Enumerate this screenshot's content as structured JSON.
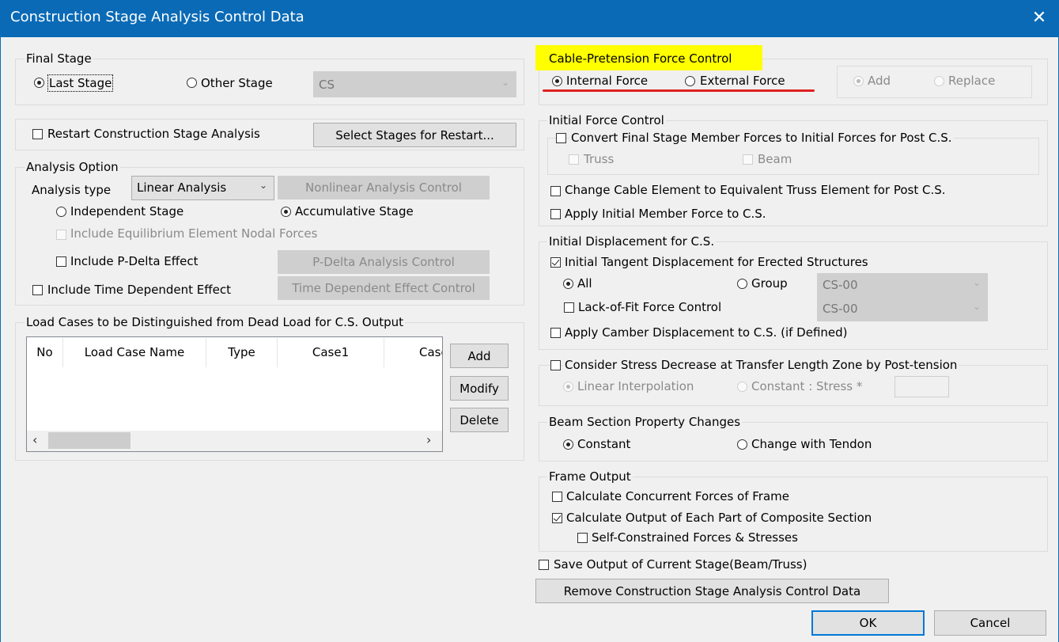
{
  "window": {
    "title": "Construction Stage Analysis Control Data"
  },
  "final_stage": {
    "label": "Final Stage",
    "last_stage": "Last Stage",
    "other_stage": "Other Stage",
    "stage_value": "CS"
  },
  "restart": {
    "label": "Restart Construction Stage Analysis",
    "select_button": "Select Stages for Restart..."
  },
  "analysis_option": {
    "label": "Analysis Option",
    "type_label": "Analysis type",
    "type_value": "Linear Analysis",
    "nonlinear_button": "Nonlinear Analysis Control",
    "independent": "Independent Stage",
    "accumulative": "Accumulative Stage",
    "equilibrium": "Include Equilibrium Element Nodal Forces",
    "pdelta": "Include P-Delta Effect",
    "pdelta_button": "P-Delta Analysis Control",
    "time_dependent": "Include Time Dependent Effect",
    "time_button": "Time Dependent Effect Control"
  },
  "load_cases": {
    "label": "Load Cases to be Distinguished from Dead Load for C.S. Output",
    "columns": [
      "No",
      "Load Case Name",
      "Type",
      "Case1",
      "Case"
    ],
    "add": "Add",
    "modify": "Modify",
    "delete": "Delete",
    "scroll_left": "‹",
    "scroll_right": "›"
  },
  "cable": {
    "label": "Cable-Pretension Force Control",
    "internal": "Internal Force",
    "external": "External Force",
    "add": "Add",
    "replace": "Replace",
    "highlight_color": "#ffff00",
    "underline_color": "#e02020"
  },
  "initial_force": {
    "label": "Initial Force Control",
    "convert": "Convert Final Stage Member Forces to Initial Forces for Post C.S.",
    "truss": "Truss",
    "beam": "Beam",
    "change_cable": "Change Cable Element to Equivalent Truss Element for Post C.S.",
    "apply_initial": "Apply Initial Member Force to C.S."
  },
  "initial_disp": {
    "label": "Initial Displacement for C.S.",
    "tangent": "Initial Tangent Displacement for Erected Structures",
    "all": "All",
    "group": "Group",
    "group_value": "CS-00",
    "lack_of_fit": "Lack-of-Fit Force Control",
    "lack_value": "CS-00",
    "camber": "Apply Camber Displacement to C.S. (if Defined)"
  },
  "stress": {
    "label": "Consider Stress Decrease at Transfer Length Zone by Post-tension",
    "linear": "Linear Interpolation",
    "constant": "Constant : Stress *",
    "stress_value": ""
  },
  "beam_section": {
    "label": "Beam Section Property Changes",
    "constant": "Constant",
    "change_tendon": "Change with Tendon"
  },
  "frame_output": {
    "label": "Frame Output",
    "concurrent": "Calculate Concurrent Forces of Frame",
    "composite": "Calculate Output of Each Part of Composite Section",
    "self_constrained": "Self-Constrained Forces & Stresses"
  },
  "save_output": "Save Output of Current Stage(Beam/Truss)",
  "remove_button": "Remove Construction Stage Analysis Control Data",
  "ok": "OK",
  "cancel": "Cancel",
  "close_glyph": "✕",
  "combo_arrow": "⌄"
}
